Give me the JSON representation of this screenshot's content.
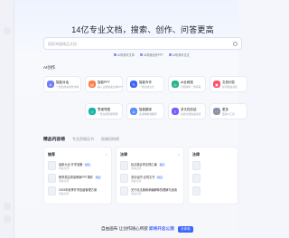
{
  "headline": "14亿专业文档，搜索、创作、问答更高效",
  "search": {
    "placeholder": "搜索海量精品文档"
  },
  "chips": [
    "AI帮我写文章",
    "AI帮我创作PPT",
    "AI帮我写论文"
  ],
  "ai_section": {
    "title": "AI创作",
    "items": [
      {
        "name": "智能对话",
        "desc": "一键生成多场景内容",
        "icon": "chat-icon",
        "color": "#6f7dff"
      },
      {
        "name": "智能PPT",
        "desc": "输入主题快速生成PPT",
        "icon": "ppt-icon",
        "color": "#ff7a45"
      },
      {
        "name": "智能写作",
        "desc": "一键生成全文",
        "icon": "pen-icon",
        "color": "#3b63ff"
      },
      {
        "name": "AI全网搜",
        "desc": "全网资料一键获取",
        "icon": "globe-icon",
        "color": "#20b486"
      },
      {
        "name": "文档问答",
        "desc": "提问快速总结",
        "icon": "doc-icon",
        "color": "#ff4d6a"
      },
      {
        "name": "思维导图",
        "desc": "一键生成思维导图",
        "icon": "mindmap-icon",
        "color": "#12b3a8"
      },
      {
        "name": "智能翻译",
        "desc": "多语种精准翻译",
        "icon": "translate-icon",
        "color": "#5b8cff"
      },
      {
        "name": "多文档总结",
        "desc": "多篇文档快速总结",
        "icon": "summary-icon",
        "color": "#7a5cff"
      },
      {
        "name": "更多",
        "desc": "更多AI工具",
        "icon": "more-icon",
        "color": "#8a94a8"
      }
    ]
  },
  "content_tabs": [
    "精品内容榜",
    "专业资格证书",
    "权威机构榜"
  ],
  "panels": [
    {
      "title": "推荐",
      "more": ">",
      "rows": [
        {
          "text": "最新大全 开学准备",
          "badge": "精选",
          "sub": "查看全部"
        },
        {
          "text": "教育类高质量教案PPT课件",
          "badge": "精选",
          "sub": "查看全部"
        },
        {
          "text": "2025年秋季开学班级管理方案",
          "badge": "",
          "sub": "查看全部"
        },
        {
          "text": "",
          "badge": "",
          "sub": ""
        }
      ]
    },
    {
      "title": "法律",
      "more": ">",
      "rows": [
        {
          "text": "民法典合同法规汇编",
          "badge": "精选",
          "sub": "查看全部"
        },
        {
          "text": "劳动合同 合同文书",
          "badge": "精选",
          "sub": "查看全部"
        },
        {
          "text": "关于民法典继承编解释的理解与适用",
          "badge": "",
          "sub": "查看全部"
        },
        {
          "text": "",
          "badge": "",
          "sub": ""
        }
      ]
    },
    {
      "title": "法律",
      "more": "",
      "rows": [
        {
          "text": "",
          "badge": "",
          "sub": ""
        },
        {
          "text": "",
          "badge": "",
          "sub": ""
        },
        {
          "text": "",
          "badge": "",
          "sub": ""
        },
        {
          "text": "",
          "badge": "",
          "sub": ""
        }
      ]
    }
  ],
  "banner": {
    "text": "自由画布 让创作随心所欲",
    "accent": "即将开启公测",
    "button": "去体验"
  }
}
